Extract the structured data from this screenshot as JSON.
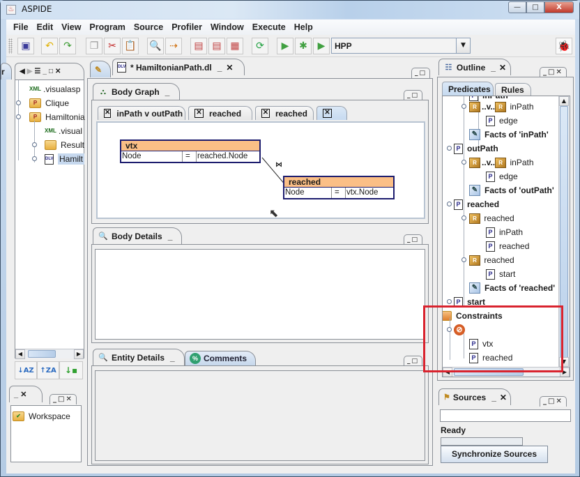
{
  "window": {
    "title": "ASPIDE",
    "app_icon": "java-cup-icon",
    "minimize": "—",
    "maximize": "□",
    "close": "X"
  },
  "menubar": [
    "File",
    "Edit",
    "View",
    "Program",
    "Source",
    "Profiler",
    "Window",
    "Execute",
    "Help"
  ],
  "toolbar": {
    "buttons": [
      "save-icon",
      "undo-icon",
      "redo-icon",
      "copy-icon",
      "cut-icon",
      "paste-icon",
      "find-icon",
      "find-replace-icon",
      "rule-icon",
      "rules-icon",
      "rules-multi-icon",
      "refresh-icon",
      "run-config-icon",
      "debug-icon",
      "run-icon"
    ],
    "program_combo": "HPP",
    "bug_icon": "debug-bug-icon"
  },
  "project_tree": {
    "items": [
      {
        "label": ".visualasp",
        "icon": "xml-file-icon"
      },
      {
        "label": "Clique",
        "icon": "project-folder-icon"
      },
      {
        "label": "Hamiltonia",
        "icon": "project-folder-icon"
      },
      {
        "label": ".visual",
        "icon": "xml-file-icon"
      },
      {
        "label": "Result",
        "icon": "folder-icon"
      },
      {
        "label": "Hamilt",
        "icon": "dlv-file-icon",
        "selected": true
      }
    ],
    "sort_buttons": [
      "sort-az-icon",
      "sort-za-icon",
      "sort-type-icon"
    ]
  },
  "workspace_panel": {
    "item": "Workspace"
  },
  "editor": {
    "tab_title": "* HamiltonianPath.dl",
    "body_graph": {
      "title": "Body Graph",
      "subtabs": [
        "inPath v outPath",
        "reached",
        "reached",
        ""
      ],
      "entities": [
        {
          "name": "vtx",
          "row": [
            "Node",
            "=",
            "reached.Node"
          ]
        },
        {
          "name": "reached",
          "row": [
            "Node",
            "=",
            "vtx.Node"
          ]
        }
      ],
      "join_symbol": "⋈"
    },
    "body_details": {
      "title": "Body Details"
    },
    "entity_details": {
      "title": "Entity Details",
      "comments_tab": "Comments"
    }
  },
  "outline": {
    "title": "Outline",
    "tabs": [
      "Predicates",
      "Rules"
    ],
    "tree": [
      {
        "label": "inPath",
        "bold": true,
        "partial": true
      },
      {
        "label": "inPath",
        "rule_disjunction": "..v..",
        "icon": "rule-icon"
      },
      {
        "label": "edge",
        "icon": "predicate-icon"
      },
      {
        "label": "Facts of 'inPath'",
        "bold": true,
        "icon": "facts-icon"
      },
      {
        "label": "outPath",
        "bold": true,
        "icon": "predicate-icon"
      },
      {
        "label": "inPath",
        "rule_disjunction": "..v..",
        "icon": "rule-icon"
      },
      {
        "label": "edge",
        "icon": "predicate-icon"
      },
      {
        "label": "Facts of 'outPath'",
        "bold": true,
        "icon": "facts-icon"
      },
      {
        "label": "reached",
        "bold": true,
        "icon": "predicate-icon"
      },
      {
        "label": "reached",
        "icon": "rule-icon"
      },
      {
        "label": "inPath",
        "icon": "predicate-icon"
      },
      {
        "label": "reached",
        "icon": "predicate-icon"
      },
      {
        "label": "reached",
        "icon": "rule-icon"
      },
      {
        "label": "start",
        "icon": "predicate-icon"
      },
      {
        "label": "Facts of 'reached'",
        "bold": true,
        "icon": "facts-icon"
      },
      {
        "label": "start",
        "bold": true,
        "icon": "predicate-icon"
      },
      {
        "label": "Constraints",
        "bold": true,
        "icon": "constraints-folder-icon"
      },
      {
        "label": "",
        "icon": "constraint-icon"
      },
      {
        "label": "vtx",
        "icon": "predicate-icon"
      },
      {
        "label": "reached",
        "icon": "predicate-icon"
      }
    ]
  },
  "sources": {
    "title": "Sources",
    "input_value": "",
    "status": "Ready",
    "progress": 0,
    "sync_button": "Synchronize Sources"
  }
}
